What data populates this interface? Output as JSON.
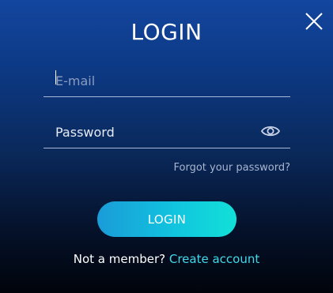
{
  "dialog": {
    "title": "LOGIN",
    "close_icon": "close-icon"
  },
  "form": {
    "email": {
      "value": "",
      "placeholder": "E-mail"
    },
    "password": {
      "value": "",
      "placeholder": "Password",
      "toggle_icon": "eye-icon"
    },
    "forgot_link": "Forgot your password?",
    "submit_label": "LOGIN"
  },
  "footer": {
    "prompt": "Not a member?",
    "link": "Create account"
  },
  "colors": {
    "accent": "#12d6e0",
    "link": "#3fd9ea",
    "background_top": "#13469f",
    "background_bottom": "#01040b"
  }
}
